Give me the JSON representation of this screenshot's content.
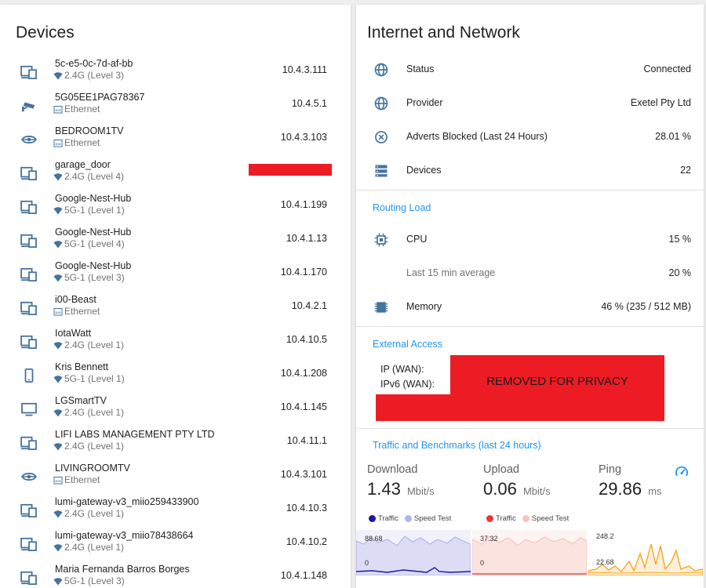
{
  "devices_card": {
    "title": "Devices",
    "items": [
      {
        "name": "5c-e5-0c-7d-af-bb",
        "conn": "2.4G (Level 3)",
        "conn_type": "wifi",
        "ip": "10.4.3.111",
        "icon": "devices-icon"
      },
      {
        "name": "5G05EE1PAG78367",
        "conn": "Ethernet",
        "conn_type": "ethernet",
        "ip": "10.4.5.1",
        "icon": "cctv-icon"
      },
      {
        "name": "BEDROOM1TV",
        "conn": "Ethernet",
        "conn_type": "ethernet",
        "ip": "10.4.3.103",
        "icon": "cast-icon"
      },
      {
        "name": "garage_door",
        "conn": "2.4G (Level 4)",
        "conn_type": "wifi",
        "ip": "",
        "redacted": true,
        "icon": "devices-icon"
      },
      {
        "name": "Google-Nest-Hub",
        "conn": "5G-1 (Level 1)",
        "conn_type": "wifi",
        "ip": "10.4.1.199",
        "icon": "devices-icon"
      },
      {
        "name": "Google-Nest-Hub",
        "conn": "5G-1 (Level 4)",
        "conn_type": "wifi",
        "ip": "10.4.1.13",
        "icon": "devices-icon"
      },
      {
        "name": "Google-Nest-Hub",
        "conn": "5G-1 (Level 3)",
        "conn_type": "wifi",
        "ip": "10.4.1.170",
        "icon": "devices-icon"
      },
      {
        "name": "i00-Beast",
        "conn": "Ethernet",
        "conn_type": "ethernet",
        "ip": "10.4.2.1",
        "icon": "devices-icon"
      },
      {
        "name": "IotaWatt",
        "conn": "2.4G (Level 1)",
        "conn_type": "wifi",
        "ip": "10.4.10.5",
        "icon": "devices-icon"
      },
      {
        "name": "Kris Bennett",
        "conn": "5G-1 (Level 1)",
        "conn_type": "wifi",
        "ip": "10.4.1.208",
        "icon": "cellphone-icon"
      },
      {
        "name": "LGSmartTV",
        "conn": "2.4G (Level 1)",
        "conn_type": "wifi",
        "ip": "10.4.1.145",
        "icon": "tv-icon"
      },
      {
        "name": "LIFI LABS MANAGEMENT PTY LTD",
        "conn": "2.4G (Level 1)",
        "conn_type": "wifi",
        "ip": "10.4.11.1",
        "icon": "devices-icon"
      },
      {
        "name": "LIVINGROOMTV",
        "conn": "Ethernet",
        "conn_type": "ethernet",
        "ip": "10.4.3.101",
        "icon": "cast-icon"
      },
      {
        "name": "lumi-gateway-v3_miio259433900",
        "conn": "2.4G (Level 1)",
        "conn_type": "wifi",
        "ip": "10.4.10.3",
        "icon": "devices-icon"
      },
      {
        "name": "lumi-gateway-v3_miio78438664",
        "conn": "2.4G (Level 1)",
        "conn_type": "wifi",
        "ip": "10.4.10.2",
        "icon": "devices-icon"
      },
      {
        "name": "Maria Fernanda Barros Borges",
        "conn": "5G-1 (Level 3)",
        "conn_type": "wifi",
        "ip": "10.4.1.148",
        "icon": "devices-icon"
      }
    ]
  },
  "network_card": {
    "title": "Internet and Network",
    "status_rows": [
      {
        "label": "Status",
        "value": "Connected",
        "icon": "globe-icon"
      },
      {
        "label": "Provider",
        "value": "Exetel Pty Ltd",
        "icon": "globe-icon"
      },
      {
        "label": "Adverts Blocked (Last 24 Hours)",
        "value": "28.01 %",
        "icon": "block-icon"
      },
      {
        "label": "Devices",
        "value": "22",
        "icon": "server-icon"
      }
    ],
    "routing_load": {
      "heading": "Routing Load",
      "cpu_label": "CPU",
      "cpu_value": "15 %",
      "avg_label": "Last 15 min average",
      "avg_value": "20 %",
      "memory_label": "Memory",
      "memory_value": "46 % (235 / 512 MB)"
    },
    "external_access": {
      "heading": "External Access",
      "ip_label": "IP (WAN):",
      "ipv6_label": "IPv6 (WAN):",
      "privacy_text": "REMOVED FOR PRIVACY"
    },
    "traffic": {
      "heading": "Traffic and Benchmarks (last 24 hours)",
      "download_label": "Download",
      "download_value": "1.43",
      "download_unit": "Mbit/s",
      "upload_label": "Upload",
      "upload_value": "0.06",
      "upload_unit": "Mbit/s",
      "ping_label": "Ping",
      "ping_value": "29.86",
      "ping_unit": "ms",
      "legend_traffic": "Traffic",
      "legend_speedtest": "Speed Test",
      "download_chart": {
        "top": "88.68",
        "bottom": "0"
      },
      "upload_chart": {
        "top": "37.32",
        "bottom": "0"
      },
      "ping_chart": {
        "top": "248.2",
        "bottom": "22.68"
      }
    }
  },
  "colors": {
    "accent": "#2196f3",
    "icon": "#44739e",
    "download_traffic": "#1a1aa6",
    "download_speedtest": "#b3b3f0",
    "upload_traffic": "#e53935",
    "upload_speedtest": "#f6c3bd",
    "ping": "#f5a623",
    "redaction": "#ed1c24"
  }
}
